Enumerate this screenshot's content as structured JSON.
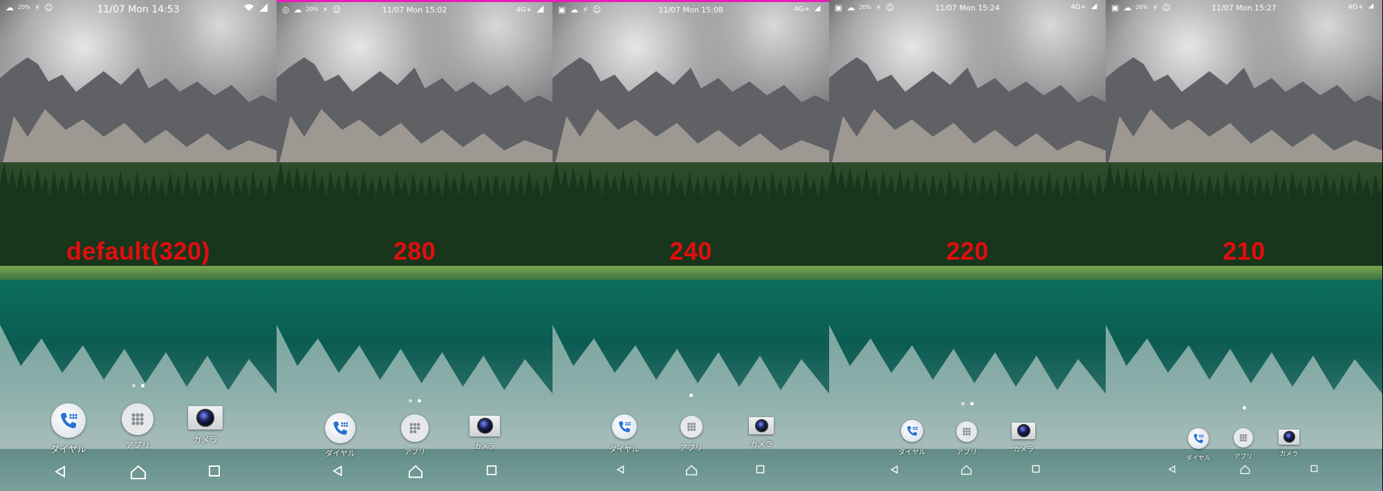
{
  "panels": [
    {
      "label": "default(320)",
      "time": "11/07 Mon 14:53",
      "battery_left": "20%",
      "network": "",
      "labels": {
        "dial": "ダイヤル",
        "apps": "アプリ",
        "camera": "カメラ"
      }
    },
    {
      "label": "280",
      "time": "11/07 Mon 15:02",
      "battery_left": "20%",
      "network": "4G+",
      "labels": {
        "dial": "ダイヤル",
        "apps": "アプリ",
        "camera": "カメラ"
      }
    },
    {
      "label": "240",
      "time": "11/07 Mon 15:08",
      "battery_left": "",
      "network": "4G+",
      "labels": {
        "dial": "ダイヤル",
        "apps": "アプリ",
        "camera": "カメラ"
      }
    },
    {
      "label": "220",
      "time": "11/07 Mon 15:24",
      "battery_left": "20%",
      "network": "4G+",
      "labels": {
        "dial": "ダイヤル",
        "apps": "アプリ",
        "camera": "カメラ"
      }
    },
    {
      "label": "210",
      "time": "11/07 Mon 15:27",
      "battery_left": "20%",
      "network": "4G+",
      "labels": {
        "dial": "ダイヤル",
        "apps": "アプリ",
        "camera": "カメラ"
      }
    }
  ],
  "colors": {
    "density_label": "#e30d0d",
    "status_accent": "#e81bb8"
  },
  "icons": {
    "dial": "phone-keypad-icon",
    "apps": "app-drawer-icon",
    "camera": "camera-icon",
    "back": "back-triangle-icon",
    "home": "home-icon",
    "recents": "recents-square-icon"
  }
}
